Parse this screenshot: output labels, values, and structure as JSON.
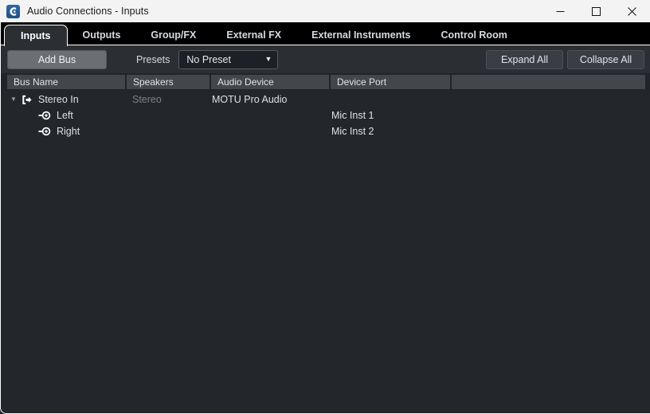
{
  "window": {
    "title": "Audio Connections - Inputs",
    "app_icon": "cubase-logo-icon",
    "controls": {
      "minimize": "minimize-icon",
      "maximize": "maximize-icon",
      "close": "close-icon"
    }
  },
  "tabs": [
    {
      "label": "Inputs",
      "active": true
    },
    {
      "label": "Outputs",
      "active": false
    },
    {
      "label": "Group/FX",
      "active": false
    },
    {
      "label": "External FX",
      "active": false
    },
    {
      "label": "External Instruments",
      "active": false
    },
    {
      "label": "Control Room",
      "active": false
    }
  ],
  "toolbar": {
    "add_bus_label": "Add Bus",
    "presets_label": "Presets",
    "preset_value": "No Preset",
    "preset_caret": "▼",
    "expand_all_label": "Expand All",
    "collapse_all_label": "Collapse All"
  },
  "columns": [
    {
      "key": "bus_name",
      "label": "Bus Name"
    },
    {
      "key": "speakers",
      "label": "Speakers"
    },
    {
      "key": "audio_device",
      "label": "Audio Device"
    },
    {
      "key": "device_port",
      "label": "Device Port"
    },
    {
      "key": "extra",
      "label": ""
    }
  ],
  "tree": {
    "bus": {
      "expanded": true,
      "twisty": "▼",
      "icon": "input-bus-icon",
      "bus_name": "Stereo In",
      "speakers": "Stereo",
      "audio_device": "MOTU Pro Audio",
      "device_port": ""
    },
    "channels": [
      {
        "icon": "audio-jack-icon",
        "bus_name": "Left",
        "speakers": "",
        "audio_device": "",
        "device_port": "Mic Inst 1"
      },
      {
        "icon": "audio-jack-icon",
        "bus_name": "Right",
        "speakers": "",
        "audio_device": "",
        "device_port": "Mic Inst 2"
      }
    ]
  },
  "colors": {
    "titlebar_bg": "#f3f3f3",
    "tabstrip_bg": "#000000",
    "panel_bg": "#2b2e33",
    "tree_bg": "#23262a",
    "header_cell_bg": "#43464b",
    "accent_button": "#6b6e73",
    "app_icon_blue": "#2b6aa8",
    "dim_text": "#7e8287"
  }
}
